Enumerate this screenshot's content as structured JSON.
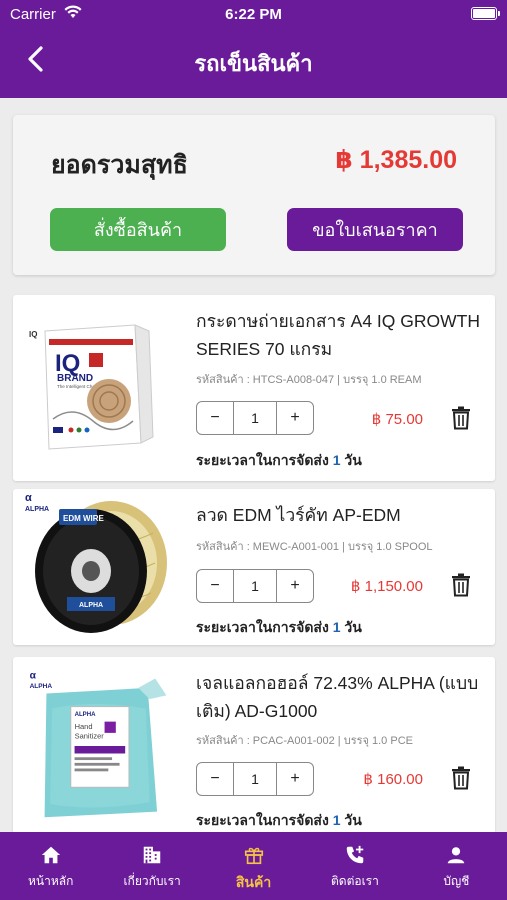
{
  "statusbar": {
    "carrier": "Carrier",
    "time": "6:22 PM"
  },
  "header": {
    "title": "รถเข็นสินค้า"
  },
  "summary": {
    "total_label": "ยอดรวมสุทธิ",
    "total_value": "฿ 1,385.00",
    "order_button": "สั่งซื้อสินค้า",
    "quote_button": "ขอใบเสนอราคา"
  },
  "colors": {
    "brand": "#6a1b9a",
    "price": "#e53935",
    "order": "#4caf50",
    "active_tab": "#f5c146"
  },
  "items": [
    {
      "name": "กระดาษถ่ายเอกสาร A4 IQ GROWTH SERIES 70 แกรม",
      "meta": "รหัสสินค้า : HTCS-A008-047 | บรรจุ 1.0 REAM",
      "qty": "1",
      "price": "฿ 75.00",
      "delivery_label": "ระยะเวลาในการจัดส่ง",
      "delivery_days": "1",
      "delivery_unit": "วัน",
      "image": {
        "brand_small": "IQ",
        "brand_big": "IQ",
        "brand_word": "BRAND",
        "tagline": "The Intelligent Choice"
      }
    },
    {
      "name": "ลวด EDM ไวร์คัท AP-EDM",
      "meta": "รหัสสินค้า : MEWC-A001-001 | บรรจุ 1.0 SPOOL",
      "qty": "1",
      "price": "฿ 1,150.00",
      "delivery_label": "ระยะเวลาในการจัดส่ง",
      "delivery_days": "1",
      "delivery_unit": "วัน",
      "image": {
        "logo": "ALPHA",
        "label": "EDM WIRE",
        "sublabel": "ALPHA"
      }
    },
    {
      "name": "เจลแอลกอฮอล์ 72.43% ALPHA (แบบเติม) AD-G1000",
      "meta": "รหัสสินค้า : PCAC-A001-002 | บรรจุ 1.0 PCE",
      "qty": "1",
      "price": "฿ 160.00",
      "delivery_label": "ระยะเวลาในการจัดส่ง",
      "delivery_days": "1",
      "delivery_unit": "วัน",
      "image": {
        "logo": "ALPHA",
        "label_logo": "ALPHA",
        "label_line1": "Hand",
        "label_line2": "Sanitizer"
      }
    }
  ],
  "tabs": [
    {
      "label": "หน้าหลัก",
      "icon": "home-icon"
    },
    {
      "label": "เกี่ยวกับเรา",
      "icon": "building-icon"
    },
    {
      "label": "สินค้า",
      "icon": "gift-icon"
    },
    {
      "label": "ติดต่อเรา",
      "icon": "phone-add-icon"
    },
    {
      "label": "บัญชี",
      "icon": "person-icon"
    }
  ]
}
